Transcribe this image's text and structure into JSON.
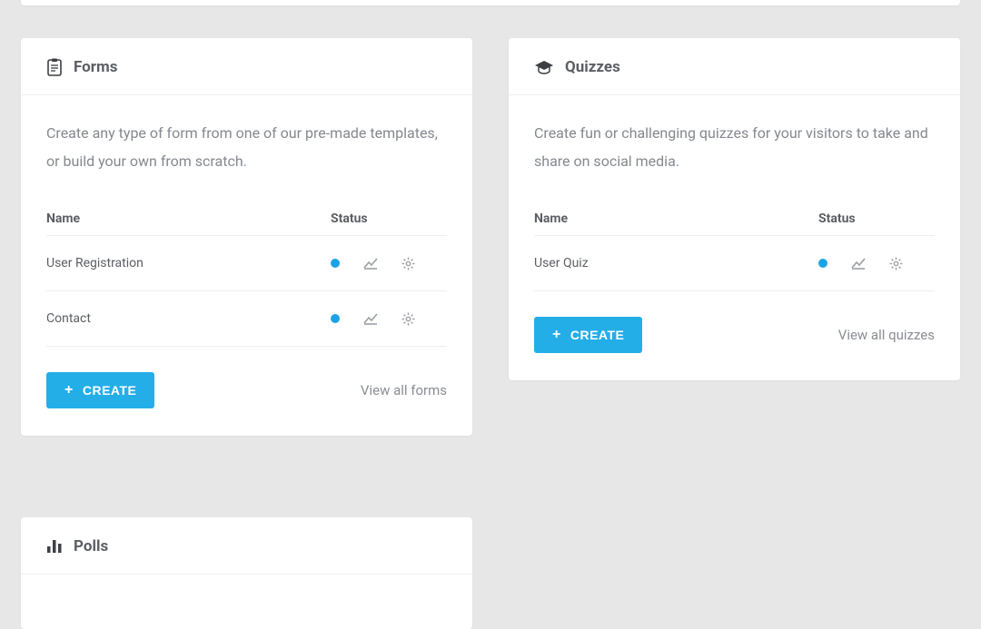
{
  "forms": {
    "title": "Forms",
    "description": "Create any type of form from one of our pre-made templates, or build your own from scratch.",
    "columns": {
      "name": "Name",
      "status": "Status"
    },
    "rows": [
      {
        "name": "User Registration"
      },
      {
        "name": "Contact"
      }
    ],
    "create_label": "CREATE",
    "view_all_label": "View all forms"
  },
  "quizzes": {
    "title": "Quizzes",
    "description": "Create fun or challenging quizzes for your visitors to take and share on social media.",
    "columns": {
      "name": "Name",
      "status": "Status"
    },
    "rows": [
      {
        "name": "User Quiz"
      }
    ],
    "create_label": "CREATE",
    "view_all_label": "View all quizzes"
  },
  "polls": {
    "title": "Polls"
  }
}
